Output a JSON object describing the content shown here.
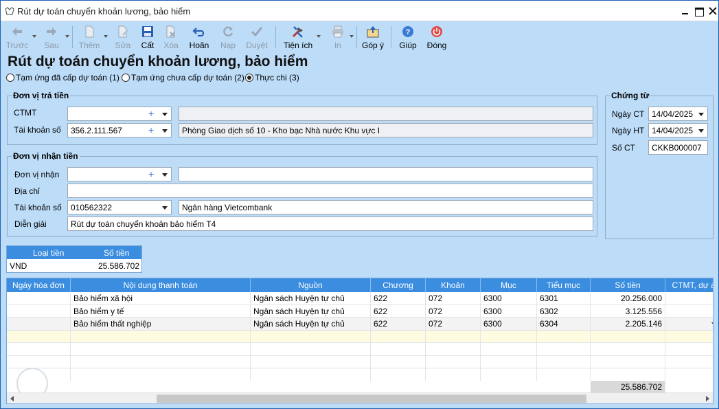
{
  "window": {
    "title": "Rút dự toán chuyển khoản lương, bảo hiểm"
  },
  "toolbar": {
    "prev": "Trước",
    "next": "Sau",
    "add": "Thêm",
    "edit": "Sửa",
    "save": "Cất",
    "delete": "Xóa",
    "undo": "Hoãn",
    "load": "Nạp",
    "approve": "Duyệt",
    "utilities": "Tiện ích",
    "print": "In",
    "feedback": "Góp ý",
    "help": "Giúp",
    "close": "Đóng"
  },
  "page": {
    "heading": "Rút dự toán chuyển khoản lương, bảo hiểm"
  },
  "modes": [
    {
      "label": "Tạm ứng đã cấp dự toán (1)",
      "selected": false
    },
    {
      "label": "Tạm ứng chưa cấp dự toán (2)",
      "selected": false
    },
    {
      "label": "Thực chi (3)",
      "selected": true
    }
  ],
  "payer": {
    "title": "Đơn vị trả tiền",
    "ctmt_label": "CTMT",
    "ctmt_value": "",
    "ctmt_desc": "",
    "account_label": "Tài khoản số",
    "account_value": "356.2.111.567",
    "account_desc": "Phòng Giao dịch số 10 - Kho bạc Nhà nước Khu vực I"
  },
  "payee": {
    "title": "Đơn vị nhận tiền",
    "unit_label": "Đơn vị nhận",
    "unit_value": "",
    "unit_desc": "",
    "address_label": "Địa chỉ",
    "address_value": "",
    "account_label": "Tài khoản số",
    "account_value": "010562322",
    "bank_value": "Ngân hàng Vietcombank",
    "desc_label": "Diễn giải",
    "desc_value": "Rút dự toán chuyển khoản bảo hiểm T4"
  },
  "voucher": {
    "title": "Chứng từ",
    "date_label": "Ngày CT",
    "date_value": "14/04/2025",
    "post_label": "Ngày HT",
    "post_value": "14/04/2025",
    "no_label": "Số CT",
    "no_value": "CKKB000007"
  },
  "currency": {
    "headers": [
      "Loại tiền",
      "Số tiền"
    ],
    "row": [
      "VND",
      "25.586.702"
    ]
  },
  "grid": {
    "headers": [
      "Ngày hóa đơn",
      "Nội dung thanh toán",
      "Nguồn",
      "Chương",
      "Khoản",
      "Mục",
      "Tiểu mục",
      "Số tiền",
      "CTMT, dự án"
    ],
    "rows": [
      [
        "",
        "Bảo hiểm xã hội",
        "Ngân sách Huyện tự chủ",
        "622",
        "072",
        "6300",
        "6301",
        "20.256.000",
        ""
      ],
      [
        "",
        "Bảo hiểm y tế",
        "Ngân sách Huyện tự chủ",
        "622",
        "072",
        "6300",
        "6302",
        "3.125.556",
        ""
      ],
      [
        "",
        "Bảo hiểm thất nghiệp",
        "Ngân sách Huyện tự chủ",
        "622",
        "072",
        "6300",
        "6304",
        "2.205.146",
        ""
      ]
    ],
    "total": "25.586.702"
  },
  "colors": {
    "background": "#bcdcf8",
    "header": "#3b8de0",
    "close": "#e04848",
    "help": "#3a7bd5"
  }
}
